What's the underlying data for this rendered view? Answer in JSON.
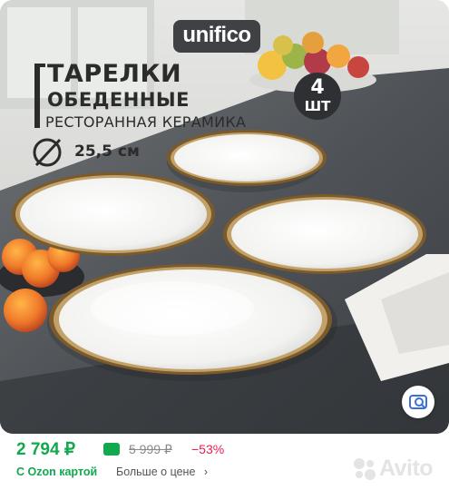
{
  "product_image": {
    "brand": "unifico",
    "title_line1": "ТАРЕЛКИ",
    "title_line2": "ОБЕДЕННЫЕ",
    "title_line3": "РЕСТОРАННАЯ КЕРАМИКА",
    "diameter": "25,5 см",
    "count_number": "4",
    "count_unit": "ШТ"
  },
  "pricing": {
    "price": "2 794 ₽",
    "old_price": "5 999 ₽",
    "discount": "−53%",
    "card_label": "С Ozon картой",
    "more_link": "Больше о цене"
  },
  "watermark": {
    "text": "Avito"
  },
  "colors": {
    "price_green": "#11a84e",
    "discount_red": "#e6214c",
    "badge_dark": "#2f3033"
  }
}
